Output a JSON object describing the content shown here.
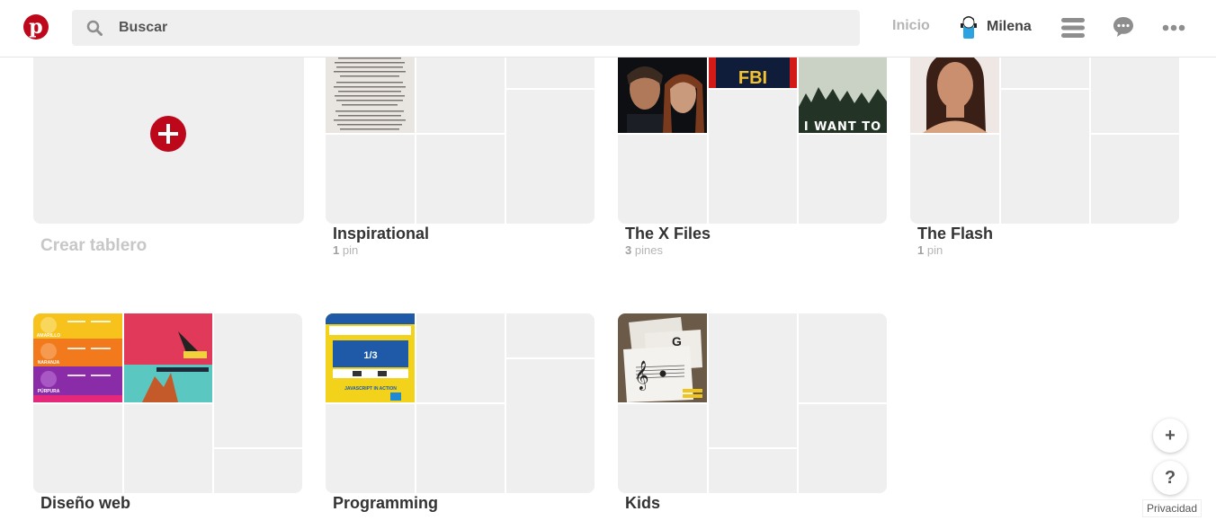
{
  "header": {
    "logo_letter": "p",
    "search_placeholder": "Buscar",
    "nav_home": "Inicio",
    "user_name": "Milena"
  },
  "create_board": {
    "label": "Crear tablero"
  },
  "boards": [
    {
      "title": "Inspirational",
      "count": "1",
      "count_unit": "pin"
    },
    {
      "title": "The X Files",
      "count": "3",
      "count_unit": "pines"
    },
    {
      "title": "The Flash",
      "count": "1",
      "count_unit": "pin"
    },
    {
      "title": "Diseño web",
      "count": "",
      "count_unit": ""
    },
    {
      "title": "Programming",
      "count": "",
      "count_unit": ""
    },
    {
      "title": "Kids",
      "count": "",
      "count_unit": ""
    }
  ],
  "thumbnails": {
    "xfiles_caption": "I WANT TO",
    "fbi": "FBI",
    "js_fraction": "1/3",
    "js_caption": "JAVASCRIPT IN ACTION",
    "design_labels": [
      "AMARILLO",
      "NARANJA",
      "PÚRPURA"
    ]
  },
  "floating": {
    "add": "+",
    "help": "?",
    "privacy": "Privacidad"
  },
  "icons": [
    "pinterest-logo-icon",
    "search-icon",
    "hamburger-menu-icon",
    "chat-bubble-icon",
    "more-dots-icon",
    "plus-icon",
    "help-icon"
  ],
  "colors": {
    "brand": "#bd081c",
    "placeholder": "#efefef"
  }
}
